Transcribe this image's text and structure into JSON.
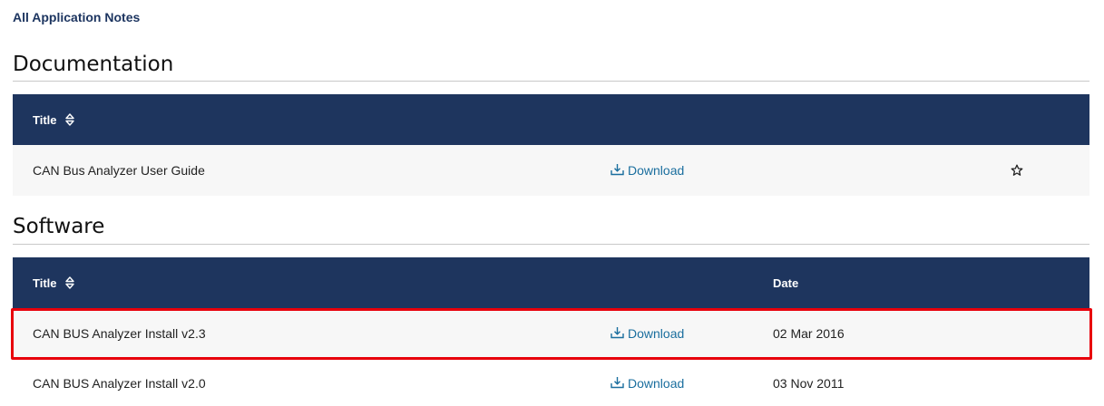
{
  "breadcrumb": {
    "label": "All Application Notes"
  },
  "documentation": {
    "title": "Documentation",
    "columns": {
      "title": "Title"
    },
    "rows": [
      {
        "title": "CAN Bus Analyzer User Guide",
        "download": "Download"
      }
    ]
  },
  "software": {
    "title": "Software",
    "columns": {
      "title": "Title",
      "date": "Date"
    },
    "rows": [
      {
        "title": "CAN BUS Analyzer Install v2.3",
        "download": "Download",
        "date": "02 Mar 2016"
      },
      {
        "title": "CAN BUS Analyzer Install v2.0",
        "download": "Download",
        "date": "03 Nov 2011"
      }
    ]
  },
  "icons": {
    "sort": "sort-up-down-icon",
    "download": "download-tray-icon",
    "favorite": "star-outline-icon"
  },
  "colors": {
    "header_bg": "#1e355e",
    "link": "#1a6e9e",
    "breadcrumb": "#1d3560",
    "row_shade": "#f7f7f7",
    "highlight": "#e8000b"
  }
}
